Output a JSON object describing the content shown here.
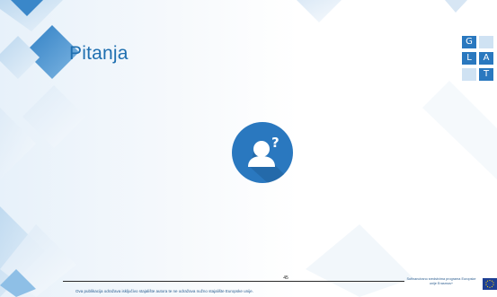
{
  "slide": {
    "title": "Pitanja",
    "page_number": "45",
    "disclaimer": "Ova publikacija odražava isključivo stajalište autora te ne odražava nužno stajalište Europske unije.",
    "funding": "Sufinancirano sredstvima programa Europske unije Erasmus+",
    "logo_letters": [
      "G",
      "L",
      "A",
      "T"
    ]
  },
  "icons": {
    "question": "person-question-icon",
    "flag": "eu-flag-icon"
  },
  "colors": {
    "accent": "#1f6fb0",
    "icon_bg": "#2a78bf",
    "logo_blue": "#2a78bf",
    "logo_light": "#cfe2f3"
  }
}
